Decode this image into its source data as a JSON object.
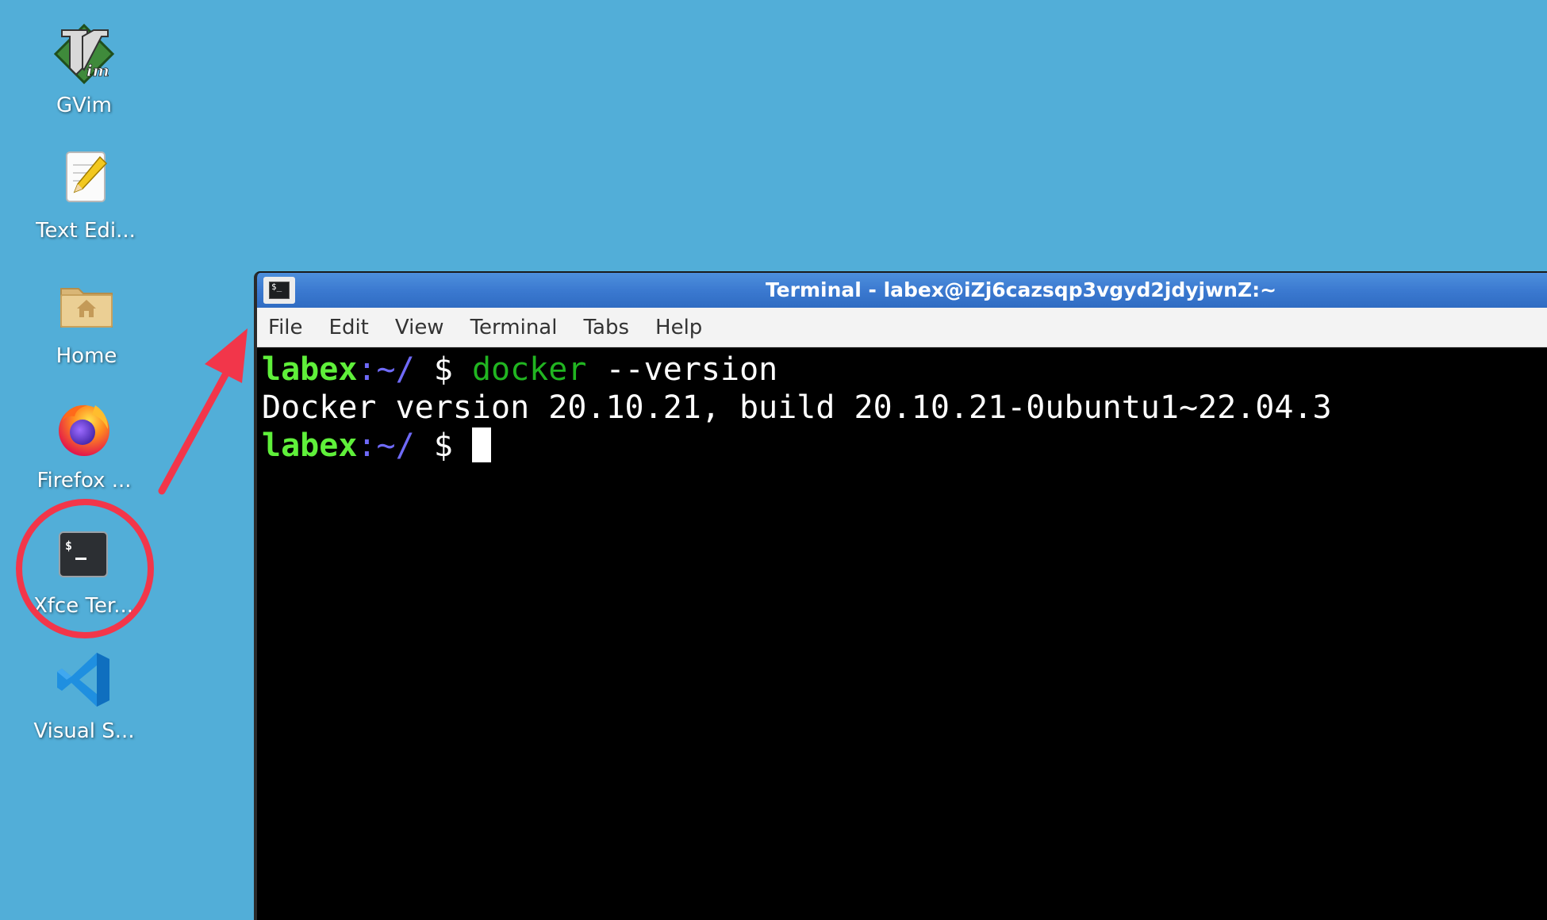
{
  "desktop": {
    "background_color": "#52aed8",
    "icons": [
      {
        "label": "GVim",
        "icon": "gvim-icon"
      },
      {
        "label": "Text Edi...",
        "icon": "text-editor-icon"
      },
      {
        "label": "Home",
        "icon": "home-folder-icon"
      },
      {
        "label": "Firefox ...",
        "icon": "firefox-icon"
      },
      {
        "label": "Xfce Ter...",
        "icon": "terminal-icon"
      },
      {
        "label": "Visual S...",
        "icon": "vscode-icon"
      }
    ]
  },
  "annotation": {
    "color": "#f2364a",
    "circle_target": "Xfce Ter...",
    "arrow_target": "terminal-window"
  },
  "terminal": {
    "title": "Terminal - labex@iZj6cazsqp3vgyd2jdyjwnZ:~",
    "menu": [
      "File",
      "Edit",
      "View",
      "Terminal",
      "Tabs",
      "Help"
    ],
    "colors": {
      "user": "#5ff03a",
      "path": "#6f6af8",
      "command": "#21b521",
      "text": "#ffffff",
      "background": "#000000"
    },
    "lines": [
      {
        "user": "labex",
        "sep": ":",
        "path": "~/",
        "prompt": " $ ",
        "command": "docker",
        "args": " --version"
      },
      {
        "output": "Docker version 20.10.21, build 20.10.21-0ubuntu1~22.04.3"
      },
      {
        "user": "labex",
        "sep": ":",
        "path": "~/",
        "prompt": " $ "
      }
    ]
  }
}
